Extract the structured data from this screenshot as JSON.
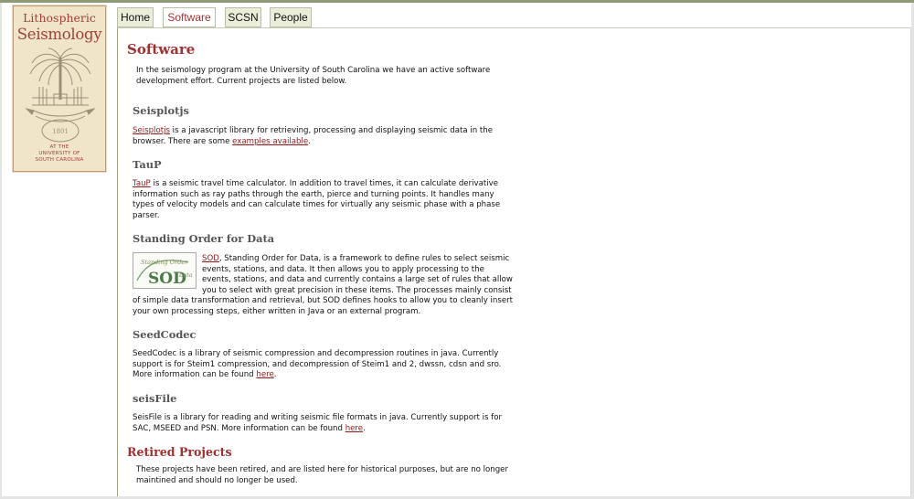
{
  "logo": {
    "line1": "Lithospheric",
    "line2": "Seismology",
    "seal_year": "1801",
    "sub1": "At the",
    "sub2": "University of",
    "sub3": "South Carolina"
  },
  "tabs": [
    {
      "label": "Home",
      "active": false
    },
    {
      "label": "Software",
      "active": true
    },
    {
      "label": "SCSN",
      "active": false
    },
    {
      "label": "People",
      "active": false
    }
  ],
  "page": {
    "title": "Software",
    "intro_line1": "In the seismology program at the University of South Carolina we have an active software",
    "intro_line2": "development effort. Current projects are listed below."
  },
  "seisplotjs": {
    "heading": "Seisplotjs",
    "link": "Seisplotjs",
    "text_a": " is a javascript library for retrieving, processing and displaying seismic data in the",
    "text_b": "browser. There are some ",
    "examples_link": "examples available",
    "text_c": "."
  },
  "taup": {
    "heading": "TauP",
    "link": "TauP",
    "line1_rest": " is a seismic travel time calculator. In addition to travel times, it can calculate derivative",
    "line2": "information such as ray paths through the earth, pierce and turning points. It handles many",
    "line3": "types of velocity models and can calculate times for virtually any seismic phase with a phase",
    "line4": "parser."
  },
  "sod": {
    "heading": "Standing Order for Data",
    "logo_text_top": "Standing Order",
    "logo_text_bottom": "Data",
    "logo_letters": "SOD",
    "link": "SOD",
    "line1_rest": ", Standing Order for Data, is a framework to define rules to select seismic",
    "line2": "events, stations, and data. It then allows you to apply processing to the",
    "line3": "events, stations, and data and currently contains a large set of rules that allow",
    "line4": "you to select with great precision in these items. The processes mainly consist",
    "line5": "of simple data transformation and retrieval, but SOD defines hooks to allow you to cleanly insert",
    "line6": "your own processing steps, either written in Java or an external program."
  },
  "seedcodec": {
    "heading": "SeedCodec",
    "line1": "SeedCodec is a library of seismic compression and decompression routines in java. Currently",
    "line2": "support is for Steim1 compression, and decompression of Steim1 and 2, dwssn, cdsn and sro.",
    "line3_a": "More information can be found ",
    "line3_link": "here",
    "line3_b": "."
  },
  "seisfile": {
    "heading": "seisFile",
    "line1": "SeisFile is a library for reading and writing seismic file formats in java. Currently support is for",
    "line2_a": "SAC, MSEED and PSN. More information can be found ",
    "line2_link": "here",
    "line2_b": "."
  },
  "retired": {
    "title": "Retired Projects",
    "line1": "These projects have been retired, and are listed here for historical purposes, but are no longer",
    "line2": "maintined and should no longer be used."
  }
}
